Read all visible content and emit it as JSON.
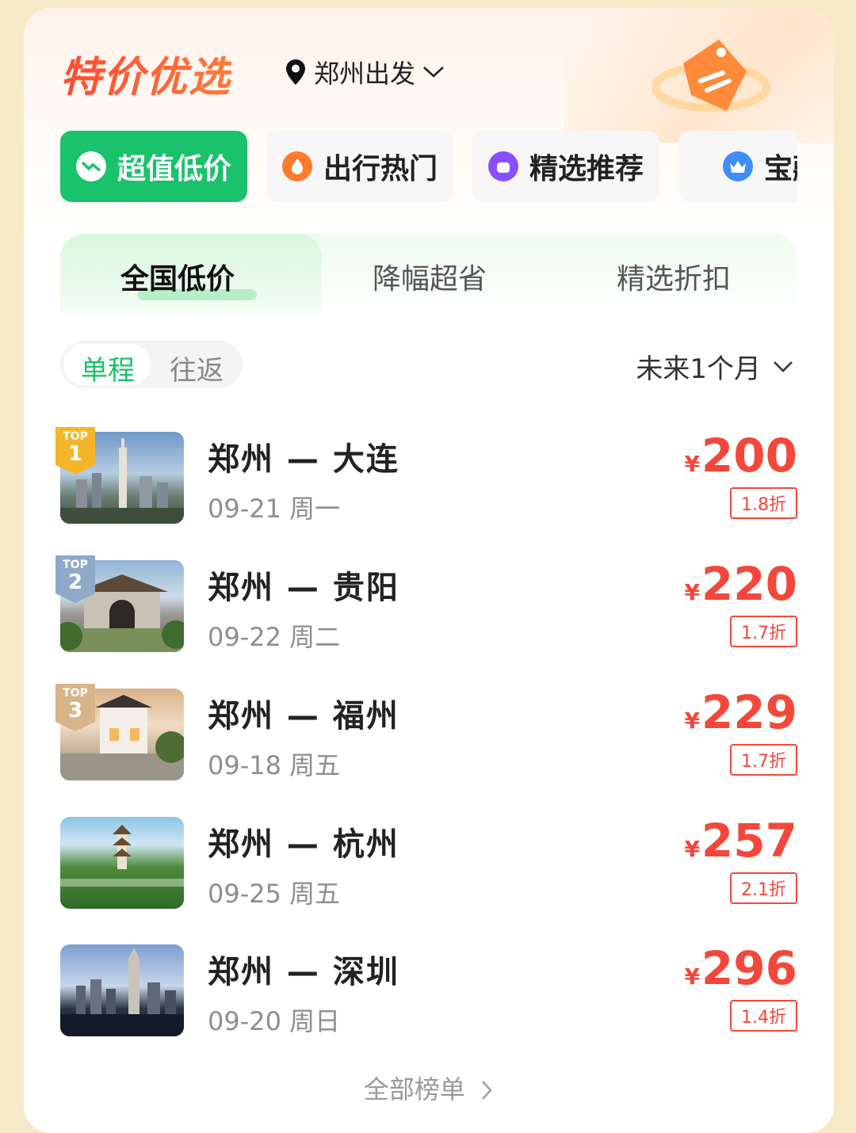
{
  "header": {
    "title": "特价优选",
    "location": "郑州出发"
  },
  "categories": [
    {
      "label": "超值低价",
      "active": true
    },
    {
      "label": "出行热门",
      "active": false
    },
    {
      "label": "精选推荐",
      "active": false
    },
    {
      "label": "宝藏",
      "active": false
    }
  ],
  "subtabs": [
    "全国低价",
    "降幅超省",
    "精选折扣"
  ],
  "trip_toggle": {
    "one_way": "单程",
    "round_trip": "往返"
  },
  "range": "未来1个月",
  "routes": [
    {
      "badge_top": "TOP",
      "rank": "1",
      "route": "郑州 — 大连",
      "date": "09-21 周一",
      "currency": "¥",
      "price": "200",
      "discount": "1.8折"
    },
    {
      "badge_top": "TOP",
      "rank": "2",
      "route": "郑州 — 贵阳",
      "date": "09-22 周二",
      "currency": "¥",
      "price": "220",
      "discount": "1.7折"
    },
    {
      "badge_top": "TOP",
      "rank": "3",
      "route": "郑州 — 福州",
      "date": "09-18 周五",
      "currency": "¥",
      "price": "229",
      "discount": "1.7折"
    },
    {
      "route": "郑州 — 杭州",
      "date": "09-25 周五",
      "currency": "¥",
      "price": "257",
      "discount": "2.1折"
    },
    {
      "route": "郑州 — 深圳",
      "date": "09-20 周日",
      "currency": "¥",
      "price": "296",
      "discount": "1.4折"
    }
  ],
  "footer": {
    "more": "全部榜单"
  },
  "colors": {
    "accent_green": "#19c26b",
    "price_red": "#f4473b",
    "title_red": "#ff4b33"
  }
}
